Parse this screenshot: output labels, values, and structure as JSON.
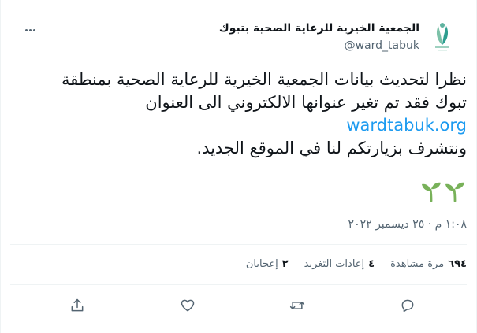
{
  "author": {
    "display_name": "الجمعية الخيرية للرعاية الصحية بتبوك",
    "handle": "@ward_tabuk",
    "avatar_icon": "ward-tabuk-logo-icon"
  },
  "menu": {
    "more_icon": "more-horizontal-icon"
  },
  "tweet": {
    "line1": "نظرا لتحديث بيانات الجمعية الخيرية للرعاية الصحية بمنطقة",
    "line2": "تبوك فقد تم تغير عنوانها الالكتروني الى العنوان",
    "link": "wardtabuk.org",
    "line3": "ونتشرف بزيارتكم لنا في الموقع الجديد.",
    "emoji_icons": [
      "seedling-icon",
      "seedling-icon"
    ]
  },
  "timestamp": "١:٠٨ م · ٢٥ ديسمبر ٢٠٢٢",
  "stats": {
    "views_count": "٦٩٤",
    "views_label": "مرة مشاهدة",
    "retweets_count": "٤",
    "retweets_label": "إعادات التغريد",
    "likes_count": "٢",
    "likes_label": "إعجابان"
  },
  "actions": [
    "reply-icon",
    "retweet-icon",
    "like-icon",
    "share-icon"
  ],
  "colors": {
    "link": "#1d9bf0",
    "muted": "#536471",
    "sprout": "#78b159",
    "brand": "#2e9e8f"
  }
}
